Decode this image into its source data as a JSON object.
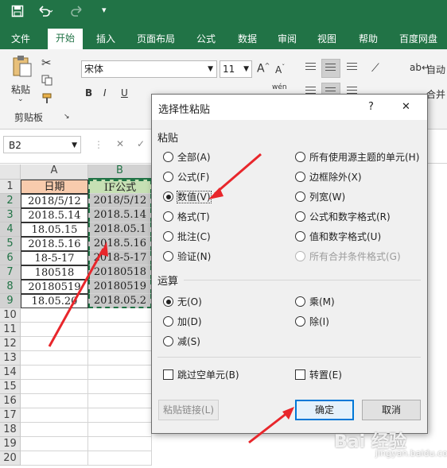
{
  "titlebar": {
    "save_icon": "save-icon",
    "undo_icon": "undo-icon",
    "redo_icon": "redo-icon"
  },
  "tabs": [
    "文件",
    "开始",
    "插入",
    "页面布局",
    "公式",
    "数据",
    "审阅",
    "视图",
    "帮助",
    "百度网盘"
  ],
  "ribbon": {
    "paste_label": "粘贴",
    "clipboard_group": "剪贴板",
    "font_name": "宋体",
    "font_size": "11",
    "bold": "B",
    "italic": "I",
    "underline": "U",
    "wen": "wén",
    "wrap_text": "自动",
    "merge": "合并"
  },
  "formula_bar": {
    "name_box": "B2",
    "cancel": "✕",
    "confirm": "✓"
  },
  "sheet": {
    "columns": [
      "A",
      "B"
    ],
    "rows": [
      "1",
      "2",
      "3",
      "4",
      "5",
      "6",
      "7",
      "8",
      "9",
      "10",
      "11",
      "12",
      "13",
      "14",
      "15",
      "16",
      "17",
      "18",
      "19",
      "20"
    ],
    "colA": [
      "日期",
      "2018/5/12",
      "2018.5.14",
      "18.05.15",
      "2018.5.16",
      "18-5-17",
      "180518",
      "20180519",
      "18.05.20"
    ],
    "colB": [
      "IF公式",
      "2018/5/12",
      "2018.5.14",
      "2018.05.1",
      "2018.5.16",
      "2018-5-17",
      "20180518",
      "20180519",
      "2018.05.2"
    ]
  },
  "dialog": {
    "title": "选择性粘贴",
    "help": "?",
    "close": "✕",
    "paste_group": "粘贴",
    "paste_options_left": [
      "全部(A)",
      "公式(F)",
      "数值(V)",
      "格式(T)",
      "批注(C)",
      "验证(N)"
    ],
    "paste_options_right": [
      "所有使用源主题的单元(H)",
      "边框除外(X)",
      "列宽(W)",
      "公式和数字格式(R)",
      "值和数字格式(U)",
      "所有合并条件格式(G)"
    ],
    "selected_paste": "数值(V)",
    "operation_group": "运算",
    "op_left": [
      "无(O)",
      "加(D)",
      "减(S)"
    ],
    "op_right": [
      "乘(M)",
      "除(I)"
    ],
    "selected_op": "无(O)",
    "skip_blanks": "跳过空单元(B)",
    "transpose": "转置(E)",
    "paste_link": "粘贴链接(L)",
    "ok": "确定",
    "cancel": "取消"
  },
  "watermark": "Bai 经验",
  "watermark_sub": "jingyan.baidu.com",
  "colors": {
    "excel_green": "#217346",
    "arrow_red": "#e8262b",
    "accent_blue": "#0078d7"
  }
}
